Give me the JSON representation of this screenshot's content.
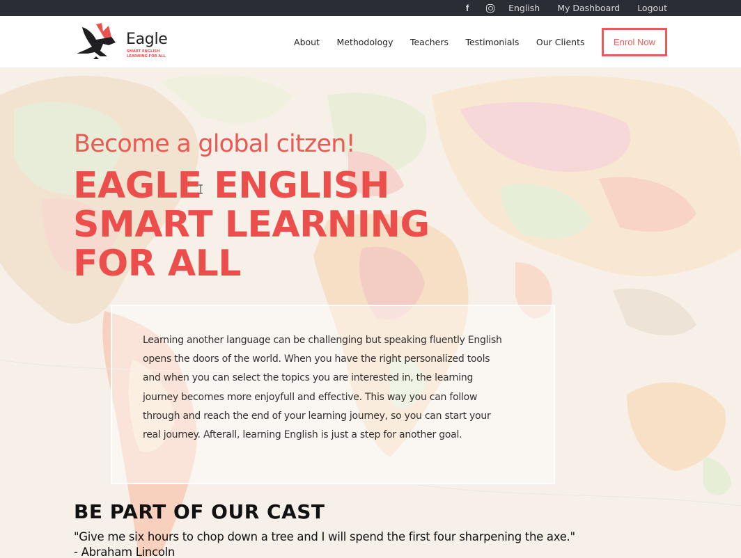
{
  "topbar": {
    "icons": [
      "facebook-icon",
      "instagram-icon"
    ],
    "facebook_glyph": "f",
    "links": [
      "English",
      "My Dashboard",
      "Logout"
    ]
  },
  "brand": {
    "name": "Eagle",
    "tagline": "SMART ENGLISH LEARNING FOR ALL",
    "icon": "eagle-logo-icon"
  },
  "nav": {
    "items": [
      "About",
      "Methodology",
      "Teachers",
      "Testimonials",
      "Our Clients"
    ],
    "enrol_label": "Enrol Now"
  },
  "hero": {
    "tagline": "Become a global citzen!",
    "headline_lines": [
      "EAGLE ENGLISH",
      "SMART LEARNING",
      "FOR ALL"
    ],
    "intro": "Learning another language can be challenging but speaking fluently English opens the doors of the world. When you have the right personalized tools and when you can select the topics you are interested in, the learning journey becomes more enjoyfull and effective. This way you can follow through and reach the end of your learning journey, so you can start your real journey. Afterall, learning English is just a step for another goal."
  },
  "cast": {
    "title": "BE PART OF OUR CAST",
    "quote": "\"Give me six hours to chop down a tree and I will spend the first four sharpening the axe.\"",
    "author": "- Abraham Lincoln"
  },
  "colors": {
    "accent": "#ec4f4b",
    "topbar_bg": "#2a2d33"
  }
}
